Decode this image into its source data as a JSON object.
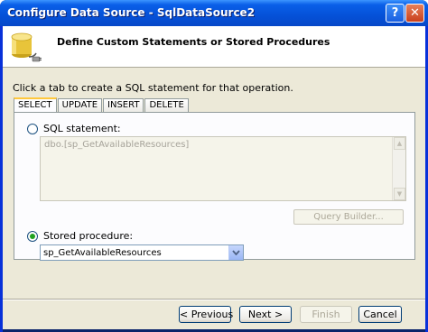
{
  "window": {
    "title": "Configure Data Source - SqlDataSource2",
    "help_label": "?",
    "close_label": "✕"
  },
  "header": {
    "title": "Define Custom Statements or Stored Procedures",
    "icon": "database-plug-icon"
  },
  "instruction": "Click a tab to create a SQL statement for that operation.",
  "tabs": [
    {
      "label": "SELECT",
      "active": true
    },
    {
      "label": "UPDATE",
      "active": false
    },
    {
      "label": "INSERT",
      "active": false
    },
    {
      "label": "DELETE",
      "active": false
    }
  ],
  "sql_statement": {
    "label": "SQL statement:",
    "value": "dbo.[sp_GetAvailableResources]",
    "selected": false
  },
  "query_builder_label": "Query Builder...",
  "stored_procedure": {
    "label": "Stored procedure:",
    "value": "sp_GetAvailableResources",
    "selected": true
  },
  "buttons": {
    "previous": "< Previous",
    "next": "Next >",
    "finish": "Finish",
    "cancel": "Cancel"
  },
  "colors": {
    "titlebar": "#0551d8",
    "dialog_bg": "#ece9d8",
    "active_tab_accent": "#ffc83c"
  }
}
